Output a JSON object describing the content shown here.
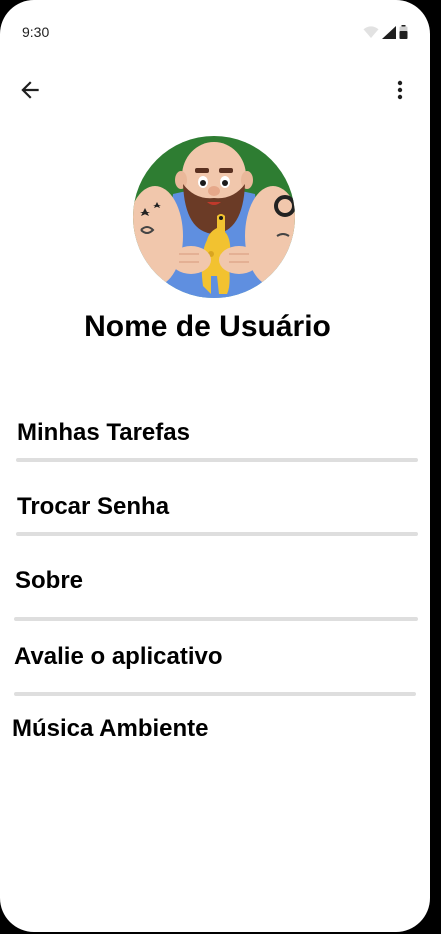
{
  "status_bar": {
    "time": "9:30"
  },
  "profile": {
    "username": "Nome de Usuário"
  },
  "menu": {
    "items": [
      {
        "label": "Minhas Tarefas"
      },
      {
        "label": "Trocar Senha"
      },
      {
        "label": "Sobre"
      },
      {
        "label": "Avalie o aplicativo"
      },
      {
        "label": "Música Ambiente"
      }
    ]
  },
  "icons": {
    "back": "arrow-left",
    "more": "more-vertical",
    "wifi": "wifi",
    "signal": "cellular-signal",
    "battery": "battery"
  },
  "colors": {
    "background": "#ffffff",
    "text": "#000000",
    "divider": "#dedede",
    "avatar_bg": "#2e7d32"
  }
}
